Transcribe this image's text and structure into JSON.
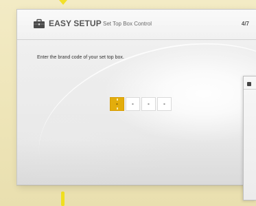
{
  "header": {
    "title": "EASY SETUP",
    "subtitle": "Set Top Box Control",
    "step": "4/7",
    "icon": "toolbox-icon"
  },
  "prompt": {
    "text": "Enter the brand code of your set top box."
  },
  "code_entry": {
    "digits": [
      "-",
      "-",
      "-",
      "-"
    ],
    "active_index": 0
  },
  "colors": {
    "background": "#efe7bc",
    "panel": "#ececec",
    "accent": "#e3ad0c",
    "connector": "#f2e028",
    "text": "#555555"
  },
  "side_preview": {
    "visible": true
  }
}
